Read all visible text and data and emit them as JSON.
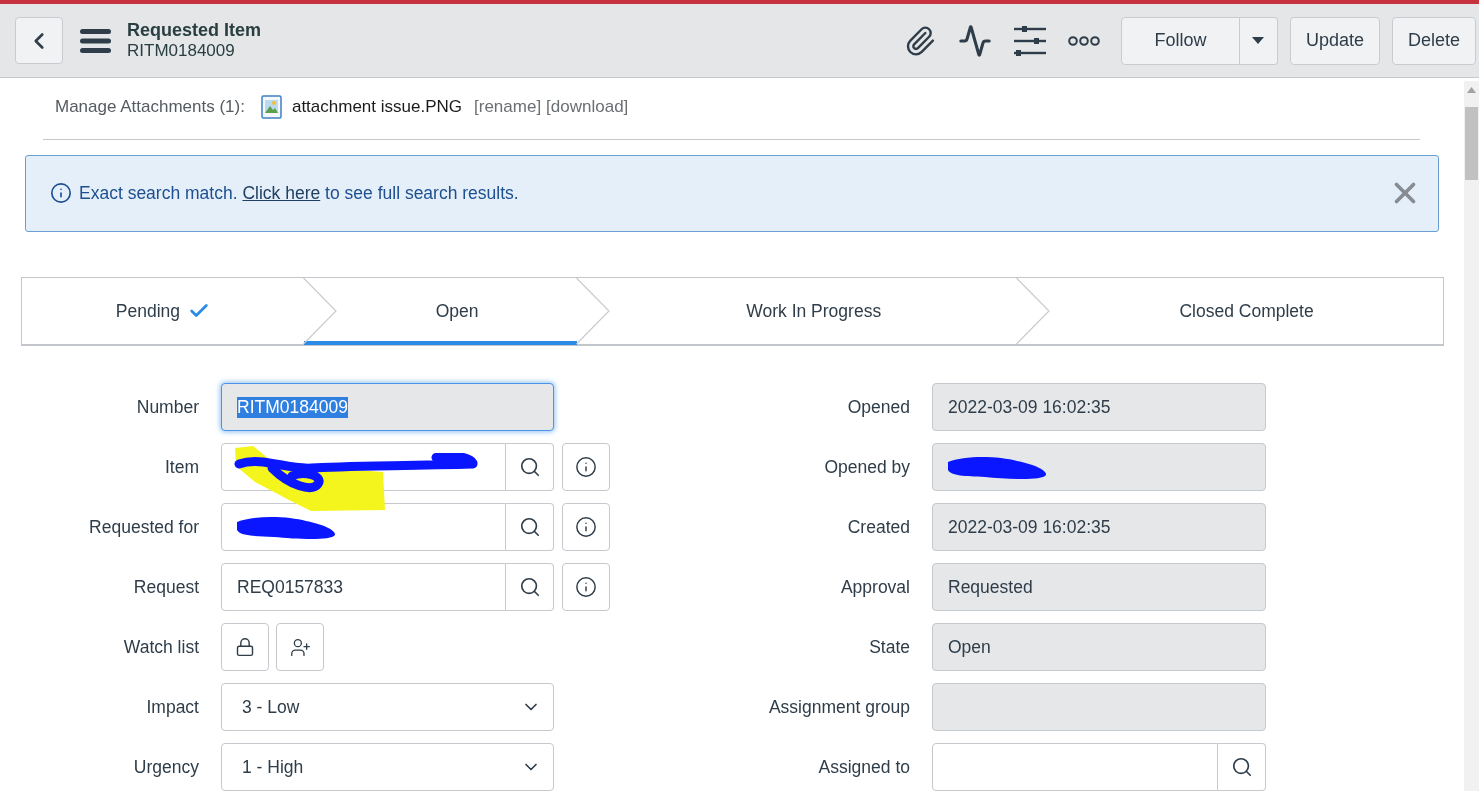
{
  "header": {
    "title": "Requested Item",
    "number": "RITM0184009",
    "follow_label": "Follow",
    "buttons": [
      "Update",
      "Delete"
    ]
  },
  "attachments": {
    "label": "Manage Attachments (1):",
    "file_name": "attachment issue.PNG",
    "links": [
      "[rename]",
      "[download]"
    ]
  },
  "banner": {
    "before_link": "Exact search match.",
    "link": "Click here",
    "after_link": "to see full search results."
  },
  "stages": [
    {
      "label": "Pending",
      "done": true,
      "selected": false
    },
    {
      "label": "Open",
      "done": false,
      "selected": true
    },
    {
      "label": "Work In Progress",
      "done": false,
      "selected": false
    },
    {
      "label": "Closed Complete",
      "done": false,
      "selected": false
    }
  ],
  "left_fields": [
    {
      "label": "Number",
      "kind": "text",
      "value": "RITM0184009",
      "readonly": true,
      "focused": true,
      "text_selected": true,
      "redacted": false,
      "highlighted": false
    },
    {
      "label": "Item",
      "kind": "reference",
      "readonly": false,
      "redacted": true,
      "highlighted": true
    },
    {
      "label": "Requested for",
      "kind": "reference",
      "readonly": false,
      "redacted": true,
      "highlighted": false
    },
    {
      "label": "Request",
      "kind": "reference",
      "value": "REQ0157833",
      "readonly": false,
      "redacted": false,
      "highlighted": false
    },
    {
      "label": "Watch list",
      "kind": "watchlist"
    },
    {
      "label": "Impact",
      "kind": "select",
      "value": "3 - Low",
      "readonly": false
    },
    {
      "label": "Urgency",
      "kind": "select",
      "value": "1 - High",
      "readonly": false
    }
  ],
  "right_fields": [
    {
      "label": "Opened",
      "kind": "text",
      "value": "2022-03-09 16:02:35",
      "readonly": true,
      "redacted": false,
      "highlighted": false
    },
    {
      "label": "Opened by",
      "kind": "text",
      "readonly": true,
      "redacted": true,
      "highlighted": false
    },
    {
      "label": "Created",
      "kind": "text",
      "value": "2022-03-09 16:02:35",
      "readonly": true,
      "redacted": false,
      "highlighted": false
    },
    {
      "label": "Approval",
      "kind": "text",
      "value": "Requested",
      "readonly": true,
      "redacted": false,
      "highlighted": false
    },
    {
      "label": "State",
      "kind": "text",
      "value": "Open",
      "readonly": true,
      "redacted": false,
      "highlighted": false
    },
    {
      "label": "Assignment group",
      "kind": "text",
      "readonly": true,
      "redacted": false,
      "highlighted": false
    },
    {
      "label": "Assigned to",
      "kind": "lookup",
      "readonly": false,
      "redacted": false,
      "highlighted": false
    }
  ]
}
